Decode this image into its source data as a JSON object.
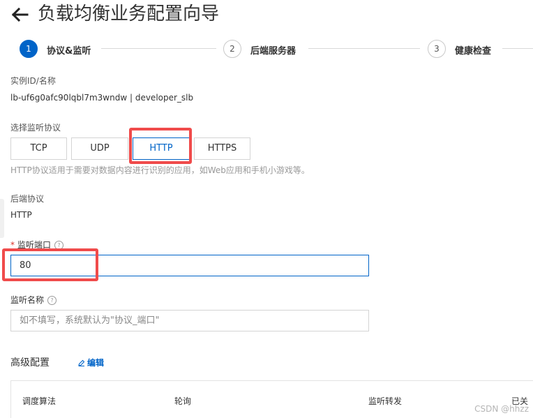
{
  "header": {
    "title": "负载均衡业务配置向导"
  },
  "steps": [
    {
      "number": "1",
      "label": "协议&监听"
    },
    {
      "number": "2",
      "label": "后端服务器"
    },
    {
      "number": "3",
      "label": "健康检查"
    }
  ],
  "instance": {
    "label": "实例ID/名称",
    "value": "lb-uf6g0afc90lqbl7m3wndw | developer_slb"
  },
  "protocol": {
    "label": "选择监听协议",
    "options": [
      "TCP",
      "UDP",
      "HTTP",
      "HTTPS"
    ],
    "selected": "HTTP",
    "help": "HTTP协议适用于需要对数据内容进行识别的应用，如Web应用和手机小游戏等。"
  },
  "backend_protocol": {
    "label": "后端协议",
    "value": "HTTP"
  },
  "listen_port": {
    "required_mark": "*",
    "label": "监听端口",
    "value": "80"
  },
  "listen_name": {
    "label": "监听名称",
    "placeholder": "如不填写，系统默认为\"协议_端口\""
  },
  "advanced": {
    "title": "高级配置",
    "edit_label": "编辑",
    "row": [
      "调度算法",
      "轮询",
      "监听转发",
      "已关"
    ]
  },
  "watermark": "CSDN @hhzz",
  "colors": {
    "accent": "#0064c8",
    "highlight": "#f04b4b"
  }
}
